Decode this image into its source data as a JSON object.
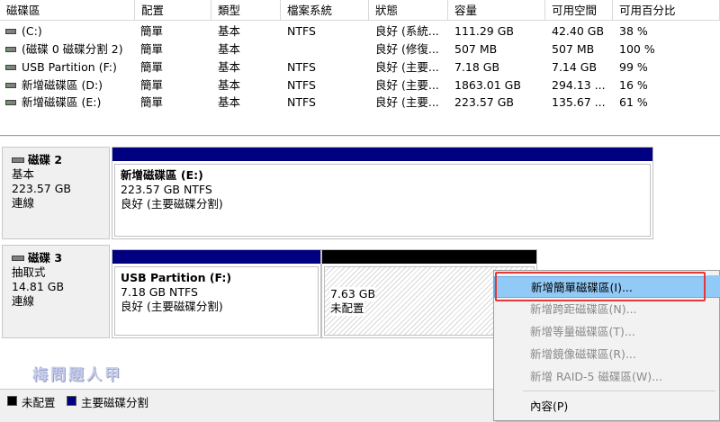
{
  "columns": [
    "磁碟區",
    "配置",
    "類型",
    "檔案系統",
    "狀態",
    "容量",
    "可用空間",
    "可用百分比"
  ],
  "volumes": [
    {
      "name": "(C:)",
      "layout": "簡單",
      "type": "基本",
      "fs": "NTFS",
      "status": "良好 (系統...",
      "capacity": "111.29 GB",
      "free": "42.40 GB",
      "pct": "38 %"
    },
    {
      "name": "(磁碟 0 磁碟分割 2)",
      "layout": "簡單",
      "type": "基本",
      "fs": "",
      "status": "良好 (修復...",
      "capacity": "507 MB",
      "free": "507 MB",
      "pct": "100 %"
    },
    {
      "name": "USB Partition (F:)",
      "layout": "簡單",
      "type": "基本",
      "fs": "NTFS",
      "status": "良好 (主要...",
      "capacity": "7.18 GB",
      "free": "7.14 GB",
      "pct": "99 %"
    },
    {
      "name": "新增磁碟區 (D:)",
      "layout": "簡單",
      "type": "基本",
      "fs": "NTFS",
      "status": "良好 (主要...",
      "capacity": "1863.01 GB",
      "free": "294.13 ...",
      "pct": "16 %"
    },
    {
      "name": "新增磁碟區 (E:)",
      "layout": "簡單",
      "type": "基本",
      "fs": "NTFS",
      "status": "良好 (主要...",
      "capacity": "223.57 GB",
      "free": "135.67 ...",
      "pct": "61 %"
    }
  ],
  "disks": [
    {
      "title": "磁碟 2",
      "kind": "基本",
      "size": "223.57 GB",
      "state": "連線",
      "partitions": [
        {
          "name": "新增磁碟區  (E:)",
          "size_fs": "223.57 GB NTFS",
          "status": "良好 (主要磁碟分割)"
        }
      ]
    },
    {
      "title": "磁碟 3",
      "kind": "抽取式",
      "size": "14.81 GB",
      "state": "連線",
      "partitions": [
        {
          "name": "USB Partition  (F:)",
          "size_fs": "7.18 GB NTFS",
          "status": "良好 (主要磁碟分割)"
        }
      ],
      "unallocated": {
        "size": "7.63 GB",
        "label": "未配置"
      }
    }
  ],
  "legend": {
    "unallocated": "未配置",
    "primary": "主要磁碟分割"
  },
  "watermark": "梅問題人甲",
  "context_menu": {
    "items": [
      {
        "label": "新增簡單磁碟區(I)...",
        "enabled": true
      },
      {
        "label": "新增跨距磁碟區(N)...",
        "enabled": false
      },
      {
        "label": "新增等量磁碟區(T)...",
        "enabled": false
      },
      {
        "label": "新增鏡像磁碟區(R)...",
        "enabled": false
      },
      {
        "label": "新增 RAID-5 磁碟區(W)...",
        "enabled": false
      }
    ],
    "properties": "內容(P)"
  },
  "colors": {
    "primary_partition": "#000080",
    "unallocated": "#000000",
    "highlight": "#91c9f7",
    "callout_border": "#e23a3a"
  }
}
